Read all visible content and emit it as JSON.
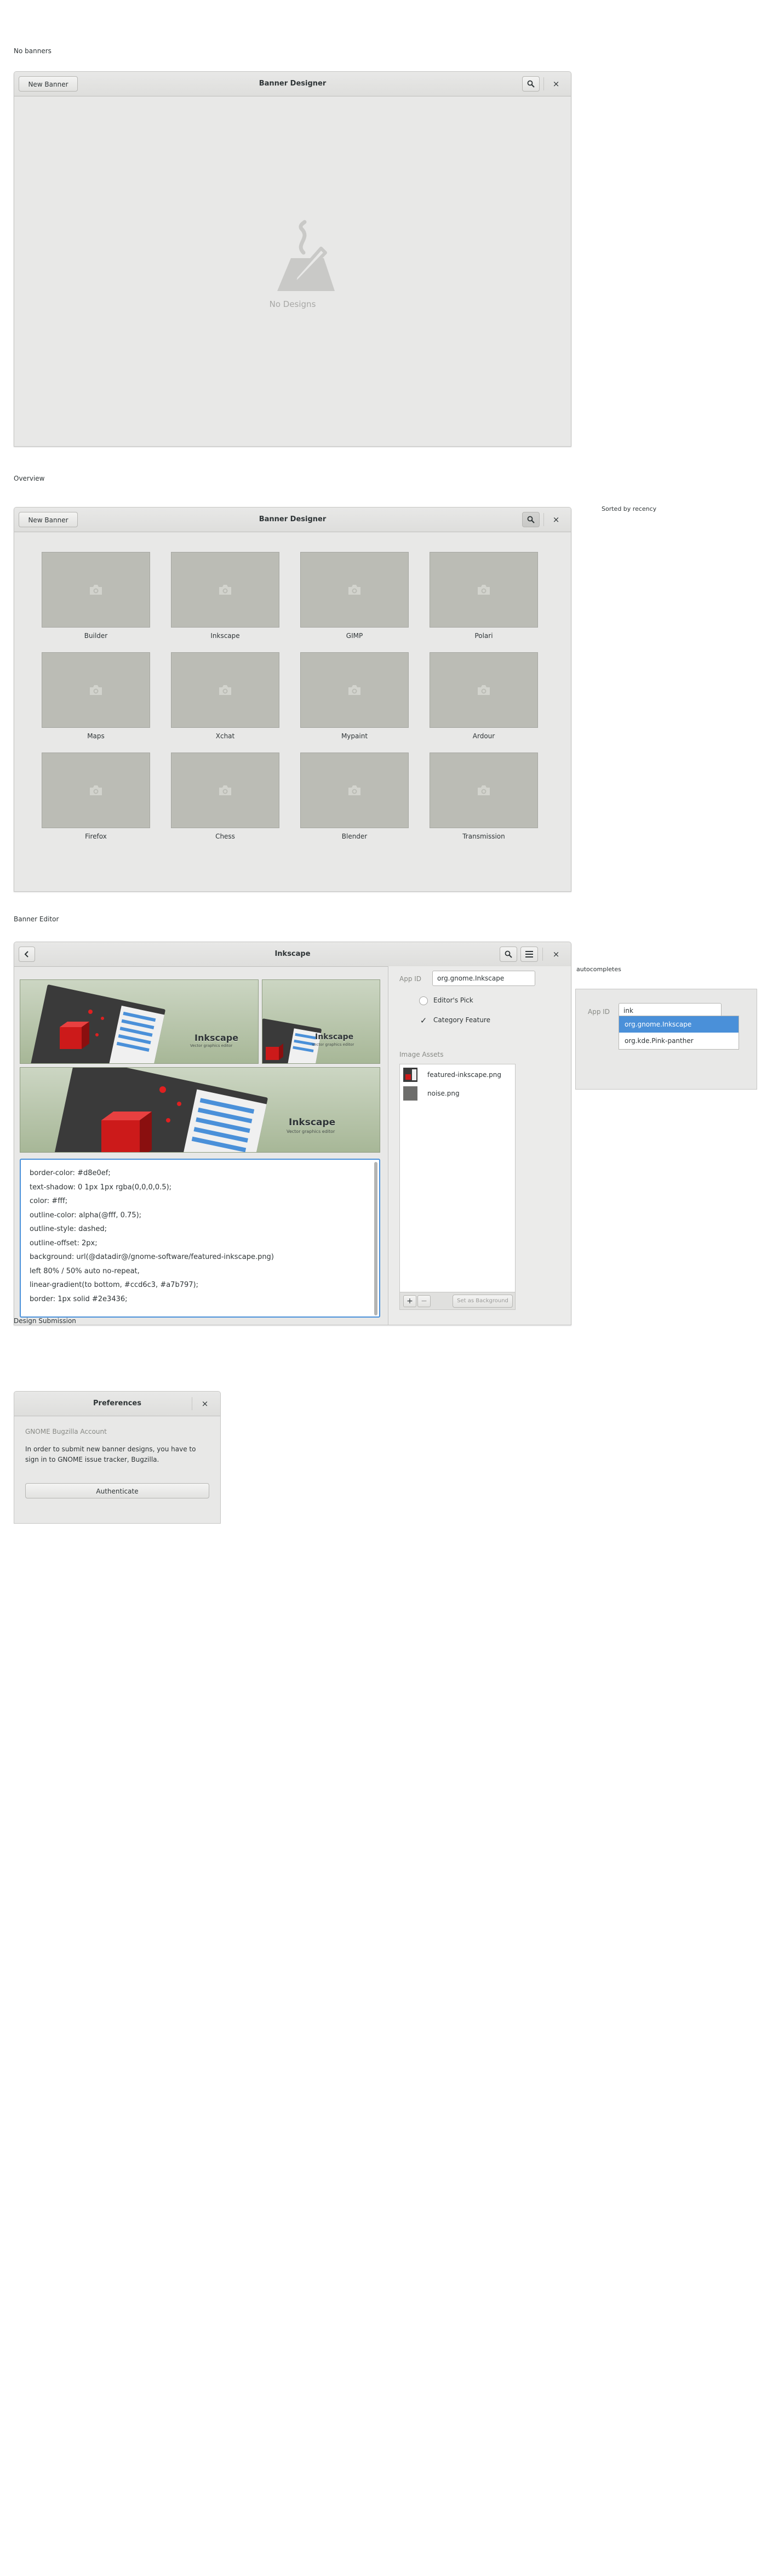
{
  "sections": {
    "no_banners": "No banners",
    "overview": "Overview",
    "banner_editor": "Banner Editor",
    "design_submission": "Design Submission"
  },
  "notes": {
    "sorted_by_recency": "Sorted by recency",
    "autocompletes": "autocompletes"
  },
  "empty_window": {
    "new_banner": "New Banner",
    "title": "Banner Designer",
    "empty_text": "No Designs",
    "icons": [
      "search-icon",
      "close-icon",
      "edit-icon"
    ]
  },
  "overview_window": {
    "new_banner": "New Banner",
    "title": "Banner Designer",
    "apps": [
      "Builder",
      "Inkscape",
      "GIMP",
      "Polari",
      "Maps",
      "Xchat",
      "Mypaint",
      "Ardour",
      "Firefox",
      "Chess",
      "Blender",
      "Transmission"
    ]
  },
  "editor_window": {
    "title": "Inkscape",
    "banner_title": "Inkscape",
    "banner_subtitle": "Vector graphics editor",
    "css_lines": [
      "border-color: #d8e0ef;",
      "text-shadow: 0 1px 1px rgba(0,0,0,0.5);",
      "color: #fff;",
      "outline-color: alpha(@fff, 0.75);",
      "outline-style: dashed;",
      "outline-offset: 2px;",
      "background: url(@datadir@/gnome-software/featured-inkscape.png)",
      "left 80% / 50% auto no-repeat,",
      "linear-gradient(to bottom, #ccd6c3, #a7b797);",
      "border: 1px solid #2e3436;"
    ],
    "app_id_label": "App ID",
    "app_id_value": "org.gnome.Inkscape",
    "editors_pick": "Editor's Pick",
    "editors_pick_checked": false,
    "category_feature": "Category Feature",
    "category_feature_checked": true,
    "image_assets_label": "Image Assets",
    "assets": [
      "featured-inkscape.png",
      "noise.png"
    ],
    "add": "+",
    "remove": "−",
    "set_background": "Set as Background",
    "colors": {
      "banner_top": "#ccd6c3",
      "banner_bottom": "#a7b797",
      "accent": "#4a90d9"
    }
  },
  "autocomplete": {
    "label": "App ID",
    "typed": "ink",
    "options": [
      "org.gnome.Inkscape",
      "org.kde.Pink-panther"
    ],
    "selected_index": 0
  },
  "preferences": {
    "title": "Preferences",
    "section": "GNOME Bugzilla Account",
    "message_line1": "In order to submit new banner designs, you have to",
    "message_line2": "sign in to GNOME issue tracker, Bugzilla.",
    "authenticate": "Authenticate"
  }
}
